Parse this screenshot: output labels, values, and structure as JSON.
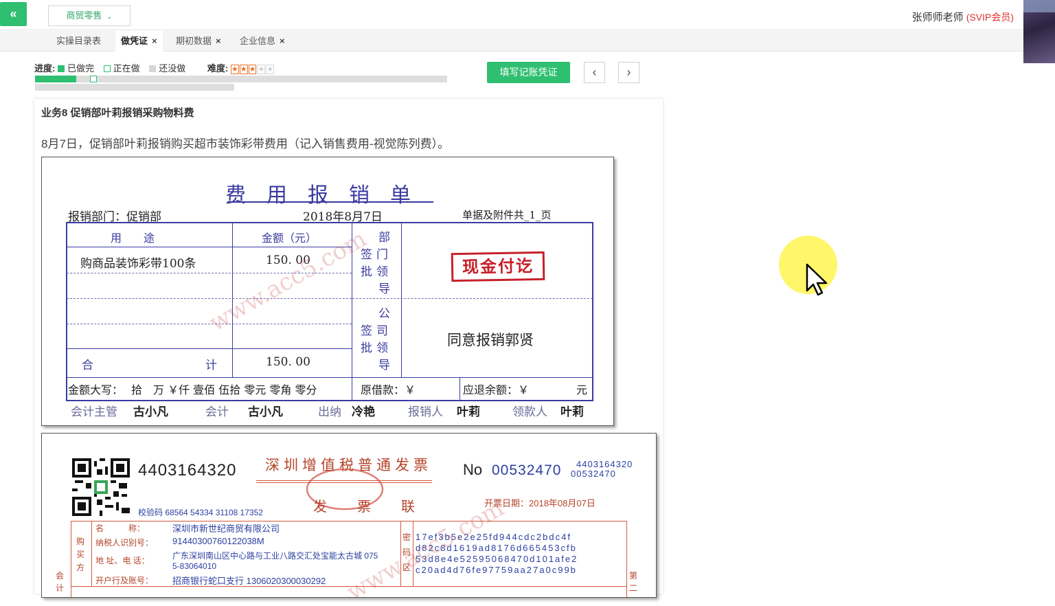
{
  "header": {
    "collapse_icon": "«",
    "industry": "商贸零售",
    "user_name": "张师师老师",
    "user_level": "(SVIP会员)"
  },
  "tabs": [
    {
      "label": "实操目录表",
      "closable": false,
      "active": false
    },
    {
      "label": "做凭证",
      "closable": true,
      "active": true
    },
    {
      "label": "期初数据",
      "closable": true,
      "active": false
    },
    {
      "label": "企业信息",
      "closable": true,
      "active": false
    }
  ],
  "progress": {
    "label": "进度:",
    "done_label": "已做完",
    "doing_label": "正在做",
    "todo_label": "还没做",
    "difficulty_label": "难度:",
    "difficulty_stars": 3,
    "difficulty_max": 5,
    "done_count": 6,
    "current_index": 8,
    "row1_count": 60,
    "row2_count": 29
  },
  "actions": {
    "fill_voucher": "填写记账凭证",
    "prev": "‹",
    "next": "›"
  },
  "business": {
    "title": "业务8 促销部叶莉报销采购物料费",
    "description": "8月7日，促销部叶莉报销购买超市装饰彩带费用（记入销售费用-视觉陈列费）。"
  },
  "expense_form": {
    "title": "费用报销单",
    "dept_label": "报销部门：促销部",
    "date": "2018年8月7日",
    "attachments": "单据及附件共_1_页",
    "col_purpose": "用　　途",
    "col_amount": "金额（元）",
    "item_purpose": "购商品装饰彩带100条",
    "item_amount": "150. 00",
    "dept_sign": [
      "部",
      "签门",
      "批领",
      "导"
    ],
    "stamp": "现金付讫",
    "company_sign": [
      "公",
      "签司",
      "批领",
      "导"
    ],
    "company_approval": "同意报销郭贤",
    "total_label_left": "合",
    "total_label_right": "计",
    "total_amount": "150. 00",
    "capital_label": "金额大写：",
    "capital_value": "拾　万 ￥仟 壹佰 伍拾 零元 零角 零分",
    "borrowed": "原借款：￥",
    "refund": "应退余额：￥",
    "refund_unit": "元",
    "accounting_supervisor_label": "会计主管",
    "accounting_supervisor": "古小凡",
    "accountant_label": "会计",
    "accountant": "古小凡",
    "cashier_label": "出纳",
    "cashier": "冷艳",
    "claimant_label": "报销人",
    "claimant": "叶莉",
    "receiver_label": "领款人",
    "receiver": "叶莉"
  },
  "invoice": {
    "code": "4403164320",
    "title": "深圳增值税普通发票",
    "copy": "发　票　联",
    "no_prefix": "No",
    "no": "00532470",
    "code_small": "4403164320",
    "no_small": "00532470",
    "check_code": "校验码 68564 54334 31108 17352",
    "issue_date": "开票日期：2018年08月07日",
    "buyer_label": "购买方",
    "name_label": "名　　　称：",
    "name": "深圳市新世纪商贸有限公司",
    "tax_id_label": "纳税人识别号：",
    "tax_id": "91440300760122038M",
    "address_label": "地 址、电 话：",
    "address": "广东深圳南山区中心路与工业八路交汇处宝能太古城 075",
    "address2": "5-83064010",
    "bank_label": "开户行及账号：",
    "bank": "招商银行蛇口支行 1306020300030292",
    "cipher_label": "密码区",
    "cipher": [
      "17ef3b5e2e25fd944cdc2bdc4f",
      "d82c8d1619ad8176d665453cfb",
      "53d8e4e52595068470d101afe2",
      "c20ad4d76fe97759aa27a0c99b"
    ],
    "left_side": "会计",
    "right_side": "第二"
  },
  "watermark": "www.acc5.com",
  "colors": {
    "accent": "#2fbf71",
    "form_blue": "#3a3aa0",
    "invoice_red": "#b4442a",
    "stamp_red": "#c6202a"
  }
}
